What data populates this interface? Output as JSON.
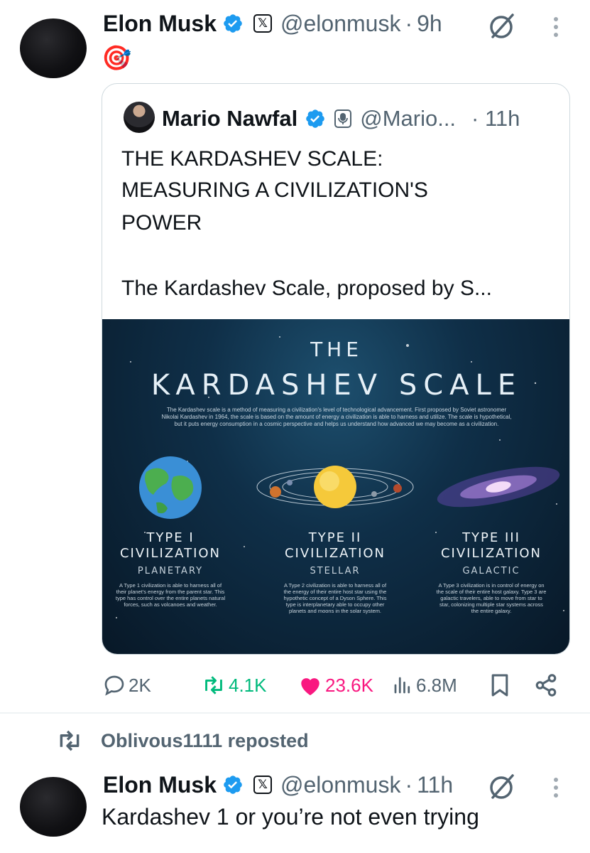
{
  "tweet1": {
    "author_name": "Elon Musk",
    "handle": "@elonmusk",
    "separator": "·",
    "time": "9h",
    "text": "🎯",
    "icons": [
      "verified-badge-icon",
      "x-affiliate-badge-icon",
      "grok-icon",
      "more-options-icon"
    ],
    "quote": {
      "author_name": "Mario Nawfal",
      "handle": "@Mario...",
      "time": "· 11h",
      "icons": [
        "verified-badge-icon",
        "podcast-affiliate-badge-icon"
      ],
      "text_line1": "THE KARDASHEV SCALE:",
      "text_line2": "MEASURING A CIVILIZATION'S",
      "text_line3": "POWER",
      "text_line4": "The Kardashev Scale, proposed by S...",
      "infographic": {
        "the": "THE",
        "title": "KARDASHEV SCALE",
        "description": "The Kardashev scale is a method of measuring a civilization's level of technological advancement. First proposed by Soviet astronomer Nikolai Kardashev in 1964, the scale is based on the amount of energy a civilization is able to harness and utilize. The scale is hypothetical, but it puts energy consumption in a cosmic perspective and helps us understand how advanced we may become as a civilization.",
        "types": [
          {
            "line1": "TYPE I",
            "line2": "CIVILIZATION",
            "sub": "PLANETARY",
            "desc": "A Type 1 civilization is able to harness all of their planet's energy from the parent star. This type has control over the entire planets natural forces, such as volcanoes and weather."
          },
          {
            "line1": "TYPE II",
            "line2": "CIVILIZATION",
            "sub": "STELLAR",
            "desc": "A Type 2 civilization is able to harness all of the energy of their entire host star using the hypothetic concept of a Dyson Sphere. This type is interplanetary able to occupy other planets and moons in the solar system."
          },
          {
            "line1": "TYPE III",
            "line2": "CIVILIZATION",
            "sub": "GALACTIC",
            "desc": "A Type 3 civilization is in control of energy on the scale of their entire host galaxy. Type 3 are galactic travelers, able to move from star to star, colonizing multiple star systems across the entire galaxy."
          }
        ]
      }
    },
    "actions": {
      "replies": "2K",
      "reposts": "4.1K",
      "likes": "23.6K",
      "views": "6.8M"
    }
  },
  "repost_label": "Oblivous1111 reposted",
  "tweet2": {
    "author_name": "Elon Musk",
    "handle": "@elonmusk",
    "separator": "·",
    "time": "11h",
    "text": "Kardashev 1 or you’re not even trying"
  },
  "colors": {
    "text": "#0f1419",
    "secondary": "#536471",
    "verified": "#1d9bf0",
    "repost_green": "#00ba7c",
    "like_pink": "#f91880",
    "border": "#cfd9de"
  }
}
